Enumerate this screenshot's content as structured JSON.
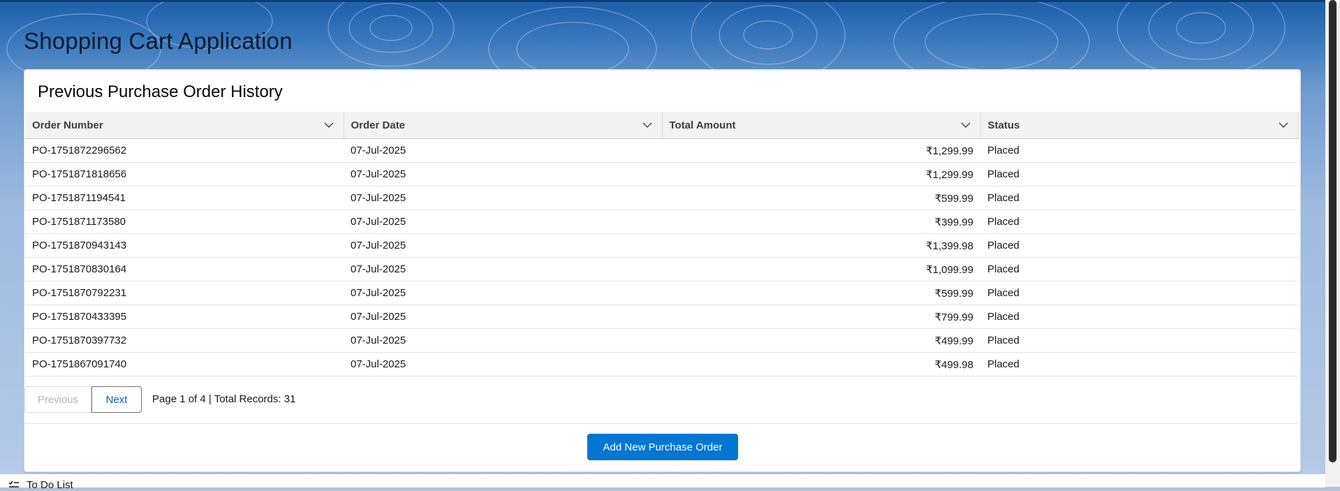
{
  "app": {
    "title": "Shopping Cart Application"
  },
  "card": {
    "title": "Previous Purchase Order History"
  },
  "table": {
    "columns": [
      "Order Number",
      "Order Date",
      "Total Amount",
      "Status"
    ],
    "rows": [
      [
        "PO-1751872296562",
        "07-Jul-2025",
        "₹1,299.99",
        "Placed"
      ],
      [
        "PO-1751871818656",
        "07-Jul-2025",
        "₹1,299.99",
        "Placed"
      ],
      [
        "PO-1751871194541",
        "07-Jul-2025",
        "₹599.99",
        "Placed"
      ],
      [
        "PO-1751871173580",
        "07-Jul-2025",
        "₹399.99",
        "Placed"
      ],
      [
        "PO-1751870943143",
        "07-Jul-2025",
        "₹1,399.98",
        "Placed"
      ],
      [
        "PO-1751870830164",
        "07-Jul-2025",
        "₹1,099.99",
        "Placed"
      ],
      [
        "PO-1751870792231",
        "07-Jul-2025",
        "₹599.99",
        "Placed"
      ],
      [
        "PO-1751870433395",
        "07-Jul-2025",
        "₹799.99",
        "Placed"
      ],
      [
        "PO-1751870397732",
        "07-Jul-2025",
        "₹499.99",
        "Placed"
      ],
      [
        "PO-1751867091740",
        "07-Jul-2025",
        "₹499.98",
        "Placed"
      ]
    ]
  },
  "pagination": {
    "previous_label": "Previous",
    "next_label": "Next",
    "info": "Page 1 of 4 | Total Records: 31"
  },
  "actions": {
    "add_label": "Add New Purchase Order"
  },
  "utility_bar": {
    "todo_label": "To Do List",
    "icon": "todo-list-icon"
  },
  "icons": {
    "column_menu": "chevron-down-icon"
  },
  "colors": {
    "brand": "#0176d3",
    "header_bg_top": "#1b5fa8",
    "link": "#0b5cab"
  }
}
